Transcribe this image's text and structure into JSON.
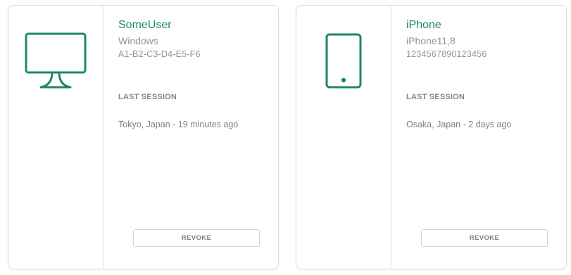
{
  "colors": {
    "accent": "#1d8a5e",
    "muted": "#8e959a",
    "border": "#d9dcde"
  },
  "devices": [
    {
      "icon": "desktop-monitor-icon",
      "name": "SomeUser",
      "os": "Windows",
      "id": "A1-B2-C3-D4-E5-F6",
      "session_heading": "LAST SESSION",
      "session_detail": "Tokyo, Japan - 19 minutes ago",
      "revoke_label": "REVOKE"
    },
    {
      "icon": "smartphone-icon",
      "name": "iPhone",
      "os": "iPhone11,8",
      "id": "1234567890123456",
      "session_heading": "LAST SESSION",
      "session_detail": "Osaka, Japan - 2 days ago",
      "revoke_label": "REVOKE"
    }
  ]
}
